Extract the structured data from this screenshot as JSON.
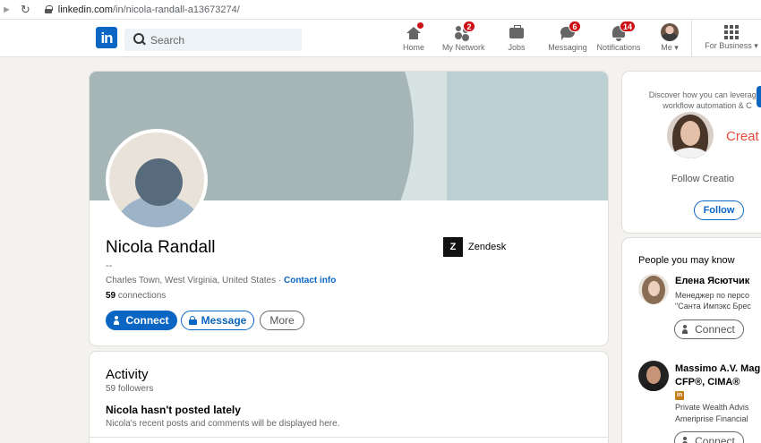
{
  "browser": {
    "url_host": "linkedin.com",
    "url_path": "/in/nicola-randall-a13673274/"
  },
  "nav": {
    "logo": "in",
    "search_placeholder": "Search",
    "items": [
      {
        "label": "Home",
        "badge": ""
      },
      {
        "label": "My Network",
        "badge": "2"
      },
      {
        "label": "Jobs",
        "badge": ""
      },
      {
        "label": "Messaging",
        "badge": "6"
      },
      {
        "label": "Notifications",
        "badge": "14"
      },
      {
        "label": "Me",
        "badge": ""
      },
      {
        "label": "For Business",
        "badge": ""
      }
    ],
    "home_dot": true
  },
  "profile": {
    "name": "Nicola Randall",
    "headline": "--",
    "location": "Charles Town, West Virginia, United States",
    "location_sep": " · ",
    "contact_info": "Contact info",
    "connections_count": "59",
    "connections_label": " connections",
    "buttons": {
      "connect": "Connect",
      "message": "Message",
      "more": "More"
    },
    "company": {
      "logo_text": "Z",
      "name": "Zendesk"
    }
  },
  "activity": {
    "title": "Activity",
    "followers": "59 followers",
    "empty_title": "Nicola hasn't posted lately",
    "empty_desc": "Nicola's recent posts and comments will be displayed here."
  },
  "ad": {
    "text_line1": "Discover how you can leverage r",
    "text_line2": "workflow automation & C",
    "brand": "Creat",
    "follow_text": "Follow Creatio",
    "follow_button": "Follow"
  },
  "pymk": {
    "title": "People you may know",
    "people": [
      {
        "name": "Елена Ясютчик",
        "line1": "Менеджер по персо",
        "line2": "\"Санта Импэкс Брес",
        "button": "Connect"
      },
      {
        "name": "Massimo A.V. Mag",
        "credentials": "CFP®, CIMA®",
        "line1": "Private Wealth Advis",
        "line2": "Ameriprise Financial",
        "button": "Connect"
      }
    ]
  },
  "colors": {
    "brand_blue": "#0a66c2",
    "badge_red": "#cc1016",
    "page_bg": "#f3f2ef"
  }
}
